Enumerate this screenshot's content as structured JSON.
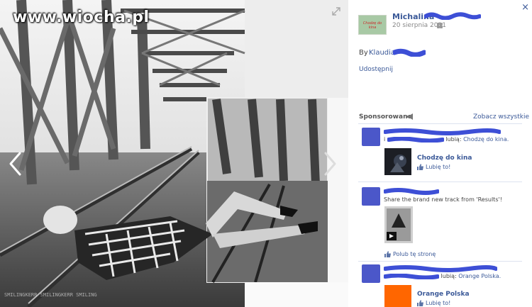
{
  "viewer": {
    "watermark": "www.wiocha.pl",
    "bottom_text": "SMILINGKERR SMILINGKERR SMILING"
  },
  "sidebar": {
    "close": "×",
    "page_thumb_label": "Chodzę do kina",
    "author": "Michalina",
    "date": "20 sierpnia 2011",
    "byline_prefix": "By",
    "byline_name": "Klaudia",
    "share": "Udostępnij"
  },
  "sponsored": {
    "heading": "Sponsorowane",
    "see_all": "Zobacz wszystkie",
    "ads": [
      {
        "prefix": "i",
        "suffix": "lubią:",
        "page_link": "Chodzę do kina.",
        "name": "Chodzę do kina",
        "like_label": "Lubię to!"
      },
      {
        "text": "Share the brand new track from 'Results'!",
        "like_label": "Polub tę stronę"
      },
      {
        "suffix": "lubią:",
        "page_link": "Orange Polska.",
        "name": "Orange Polska",
        "like_label": "Lubię to!"
      }
    ]
  },
  "colors": {
    "link": "#3b5998",
    "scribble": "#3d4fd6",
    "orange": "#ff6600"
  }
}
